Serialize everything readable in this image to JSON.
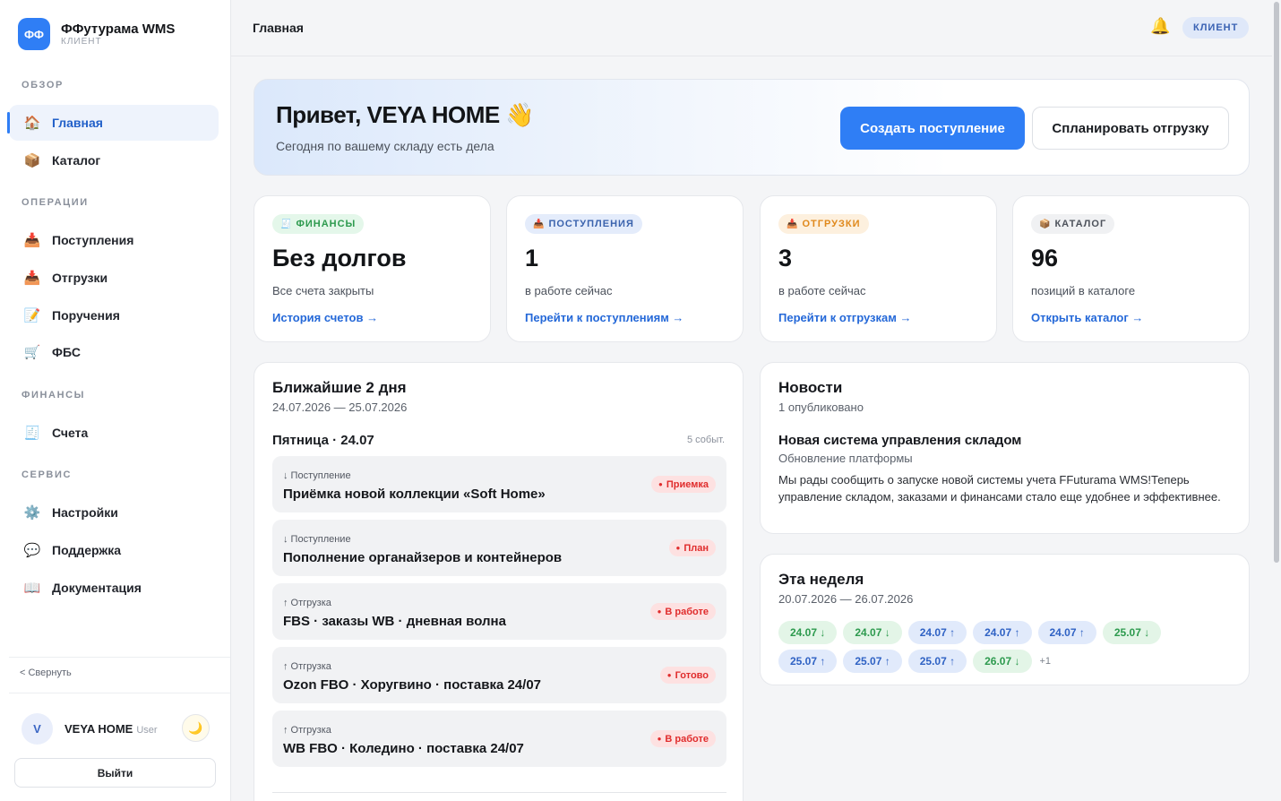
{
  "brand": {
    "logo": "ФФ",
    "name": "ФФутурама WMS",
    "sub": "КЛИЕНТ"
  },
  "sidebar": {
    "sections": [
      {
        "title": "ОБЗОР",
        "items": [
          {
            "icon": "🏠",
            "icon_name": "home-icon",
            "label": "Главная",
            "active": true
          },
          {
            "icon": "📦",
            "icon_name": "box-icon",
            "label": "Каталог"
          }
        ]
      },
      {
        "title": "ОПЕРАЦИИ",
        "items": [
          {
            "icon": "📥",
            "icon_name": "inbox-tray-icon",
            "label": "Поступления"
          },
          {
            "icon": "📥",
            "icon_name": "outbox-tray-icon",
            "label": "Отгрузки"
          },
          {
            "icon": "📝",
            "icon_name": "memo-icon",
            "label": "Поручения"
          },
          {
            "icon": "🛒",
            "icon_name": "cart-icon",
            "label": "ФБС"
          }
        ]
      },
      {
        "title": "ФИНАНСЫ",
        "items": [
          {
            "icon": "🧾",
            "icon_name": "receipt-icon",
            "label": "Счета"
          }
        ]
      },
      {
        "title": "СЕРВИС",
        "items": [
          {
            "icon": "⚙️",
            "icon_name": "gear-icon",
            "label": "Настройки"
          },
          {
            "icon": "💬",
            "icon_name": "speech-bubble-icon",
            "label": "Поддержка"
          },
          {
            "icon": "📖",
            "icon_name": "book-icon",
            "label": "Документация"
          }
        ]
      }
    ],
    "collapse_label": "< Свернуть",
    "user": {
      "initial": "V",
      "name": "VEYA HOME",
      "role": "User",
      "theme_icon": "🌙"
    },
    "logout_label": "Выйти"
  },
  "topbar": {
    "title": "Главная",
    "bell_icon": "🔔",
    "role": "КЛИЕНТ"
  },
  "hero": {
    "title": "Привет, VEYA HOME 👋",
    "subtitle": "Сегодня по вашему складу есть дела",
    "primary_button": "Создать поступление",
    "secondary_button": "Спланировать отгрузку"
  },
  "stats": [
    {
      "badge_icon": "🧾",
      "badge": "ФИНАНСЫ",
      "color": "green",
      "value": "Без долгов",
      "caption": "Все счета закрыты",
      "link": "История счетов →"
    },
    {
      "badge_icon": "📥",
      "badge": "ПОСТУПЛЕНИЯ",
      "color": "blue",
      "value": "1",
      "caption": "в работе сейчас",
      "link": "Перейти к поступлениям →"
    },
    {
      "badge_icon": "📥",
      "badge": "ОТГРУЗКИ",
      "color": "orange",
      "value": "3",
      "caption": "в работе сейчас",
      "link": "Перейти к отгрузкам →"
    },
    {
      "badge_icon": "📦",
      "badge": "КАТАЛОГ",
      "color": "gray",
      "value": "96",
      "caption": "позиций в каталоге",
      "link": "Открыть каталог →"
    }
  ],
  "upcoming": {
    "title": "Ближайшие 2 дня",
    "range": "24.07.2026 — 25.07.2026",
    "day": "Пятница · 24.07",
    "count": "5 событ.",
    "events": [
      {
        "type": "↓ Поступление",
        "title": "Приёмка новой коллекции «Soft Home»",
        "status": "Приемка"
      },
      {
        "type": "↓ Поступление",
        "title": "Пополнение органайзеров и контейнеров",
        "status": "План"
      },
      {
        "type": "↑ Отгрузка",
        "title": "FBS · заказы WB · дневная волна",
        "status": "В работе"
      },
      {
        "type": "↑ Отгрузка",
        "title": "Ozon FBO · Хоругвино · поставка 24/07",
        "status": "Готово"
      },
      {
        "type": "↑ Отгрузка",
        "title": "WB FBO · Коледино · поставка 24/07",
        "status": "В работе"
      }
    ]
  },
  "news": {
    "title": "Новости",
    "count": "1 опубликовано",
    "item": {
      "title": "Новая система управления складом",
      "category": "Обновление платформы",
      "body": "Мы рады сообщить о запуске новой системы учета FFuturama WMS!Теперь управление складом, заказами и финансами стало еще удобнее и эффективнее."
    }
  },
  "week": {
    "title": "Эта неделя",
    "range": "20.07.2026 — 26.07.2026",
    "chips": [
      {
        "label": "24.07 ↓",
        "kind": "in"
      },
      {
        "label": "24.07 ↓",
        "kind": "in"
      },
      {
        "label": "24.07 ↑",
        "kind": "out"
      },
      {
        "label": "24.07 ↑",
        "kind": "out"
      },
      {
        "label": "24.07 ↑",
        "kind": "out"
      },
      {
        "label": "25.07 ↓",
        "kind": "in"
      },
      {
        "label": "25.07 ↑",
        "kind": "out"
      },
      {
        "label": "25.07 ↑",
        "kind": "out"
      },
      {
        "label": "25.07 ↑",
        "kind": "out"
      },
      {
        "label": "26.07 ↓",
        "kind": "in"
      }
    ],
    "more": "+1"
  }
}
